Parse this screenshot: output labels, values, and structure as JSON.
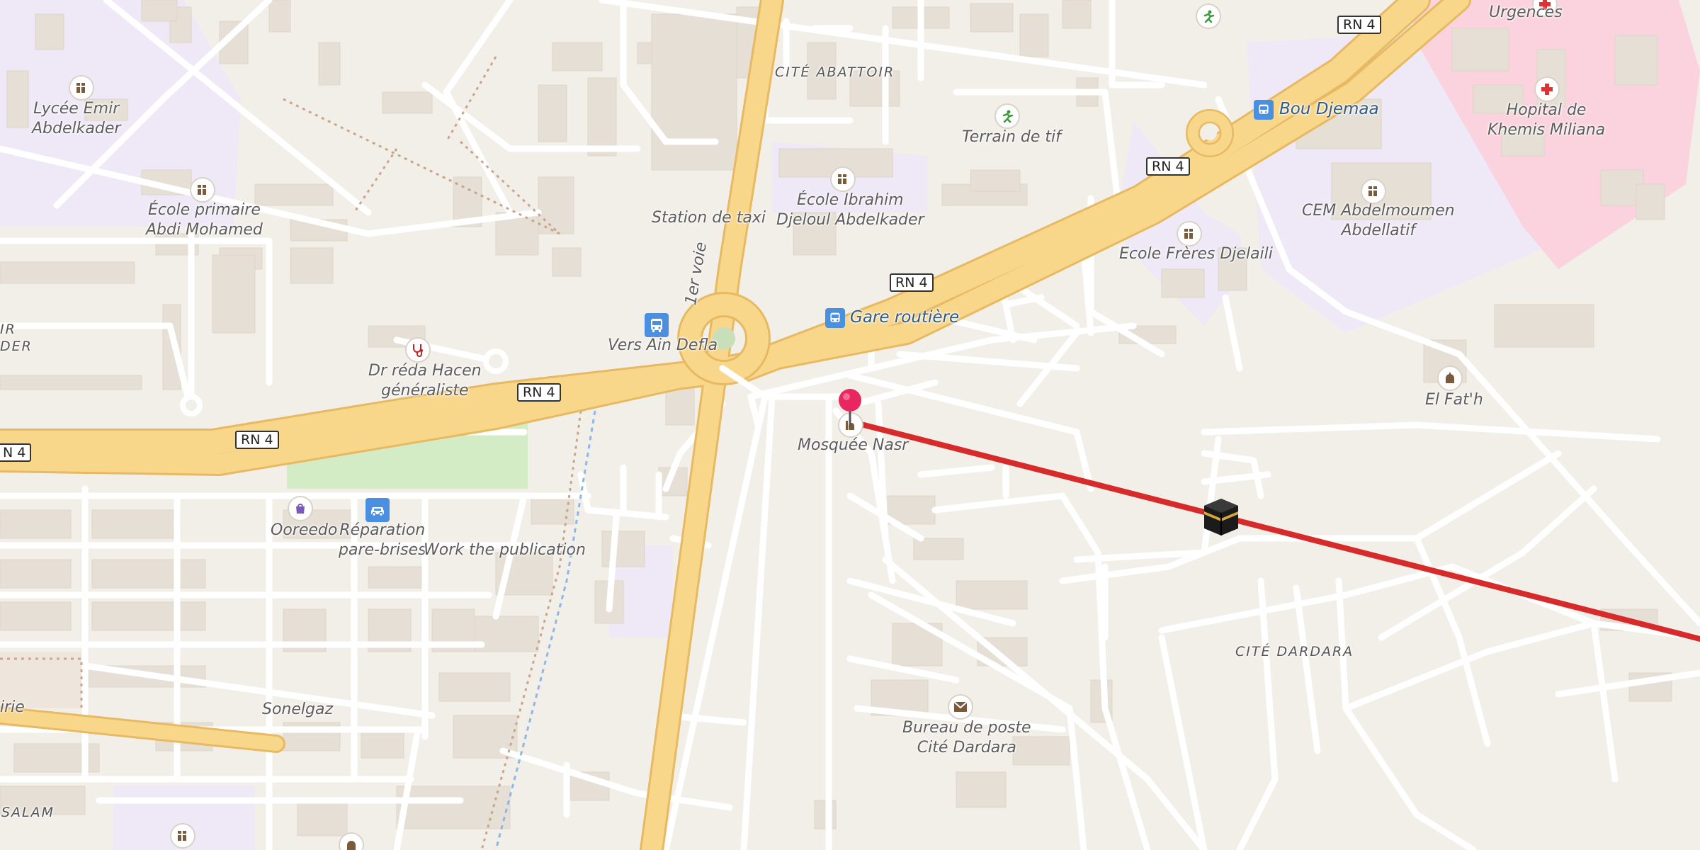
{
  "map": {
    "colors": {
      "land": "#f2efe9",
      "education_area": "#efe8f6",
      "hospital_area": "#fbd3df",
      "park": "#d4ecc6",
      "major_road": "#f8d68a",
      "major_road_casing": "#e7b963",
      "minor_road": "#ffffff",
      "building": "#e6dfd5",
      "route_line": "#d72a2a",
      "pin": "#e8265f",
      "transit_icon": "#4a8fe0"
    },
    "road_shields": [
      "RN 4",
      "RN 4",
      "RN 4",
      "RN 4",
      "RN 4",
      "N 4"
    ],
    "quarters": [
      "CITÉ ABATTOIR",
      "CITÉ DARDARA",
      "SALAM",
      "IR",
      "DER"
    ],
    "street_labels": [
      "1er voie",
      "irie"
    ],
    "places": [
      {
        "label": "Urgences",
        "icon": "hospital-icon"
      },
      {
        "label": "Lycée Emir\nAbdelkader",
        "icon": "school-icon"
      },
      {
        "label": "École primaire\nAbdi Mohamed",
        "icon": "school-icon"
      },
      {
        "label": "Terrain de tif",
        "icon": "sports-icon"
      },
      {
        "label": "Bou Djemaa",
        "icon": "bus-stop-icon"
      },
      {
        "label": "Hopital de\nKhemis Miliana",
        "icon": "hospital-icon"
      },
      {
        "label": "École Ibrahim\nDjeloul Abdelkader",
        "icon": "school-icon"
      },
      {
        "label": "CEM Abdelmoumen\nAbdellatif",
        "icon": "school-icon"
      },
      {
        "label": "Station de taxi",
        "icon": ""
      },
      {
        "label": "Ecole Frères Djelaili",
        "icon": "school-icon"
      },
      {
        "label": "Gare routière",
        "icon": "bus-stop-icon"
      },
      {
        "label": "Vers Ain Defla",
        "icon": "bus-stop-icon"
      },
      {
        "label": "Dr réda Hacen\ngénéraliste",
        "icon": "doctor-icon"
      },
      {
        "label": "El Fat'h",
        "icon": "mosque-icon"
      },
      {
        "label": "Mosquée Nasr",
        "icon": "mosque-icon"
      },
      {
        "label": "Ooreedo",
        "icon": "shop-icon"
      },
      {
        "label": "Réparation\npare-brises",
        "icon": "car-repair-icon"
      },
      {
        "label": "Work the publication",
        "icon": ""
      },
      {
        "label": "Sonelgaz",
        "icon": ""
      },
      {
        "label": "Bureau de poste\nCité Dardara",
        "icon": "post-office-icon"
      }
    ],
    "qibla_marker": "kaaba-icon",
    "selected_pin": "location-pin-icon"
  }
}
